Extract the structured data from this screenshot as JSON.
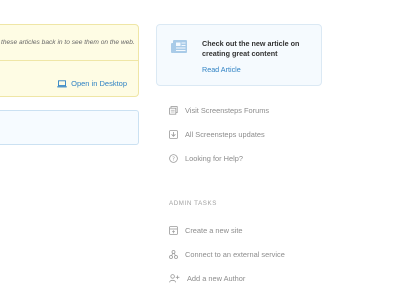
{
  "notice": {
    "text": "these articles back in to see them on the web.",
    "open_desktop_label": "Open in Desktop"
  },
  "article_card": {
    "title": "Check out the new article on creating great content",
    "link_label": "Read Article"
  },
  "links": [
    {
      "label": "Visit Screensteps Forums",
      "icon": "forum-icon"
    },
    {
      "label": "All Screensteps updates",
      "icon": "updates-icon"
    },
    {
      "label": "Looking for Help?",
      "icon": "help-icon"
    }
  ],
  "admin": {
    "heading": "ADMIN TASKS",
    "items": [
      {
        "label": "Create a new site",
        "icon": "site-icon"
      },
      {
        "label": "Connect to an external service",
        "icon": "connect-icon"
      },
      {
        "label": "Add a new Author",
        "icon": "add-author-icon"
      }
    ]
  },
  "colors": {
    "link_blue": "#2f82c4",
    "notice_bg": "#fefce4",
    "card_bg": "#f5fafe",
    "muted_text": "#8c8c8c"
  }
}
